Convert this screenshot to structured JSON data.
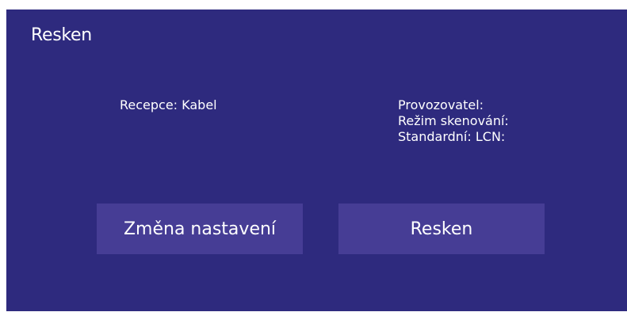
{
  "dialog": {
    "title": "Resken",
    "reception": "Recepce: Kabel",
    "info": {
      "operator": "Provozovatel:",
      "scan_mode": "Režim skenování:",
      "standard_lcn": "Standardní: LCN:"
    },
    "buttons": {
      "change_settings": "Změna nastavení",
      "rescan": "Resken"
    }
  },
  "colors": {
    "background": "#2e2a7e",
    "button": "#463d95",
    "text": "#ffffff"
  }
}
